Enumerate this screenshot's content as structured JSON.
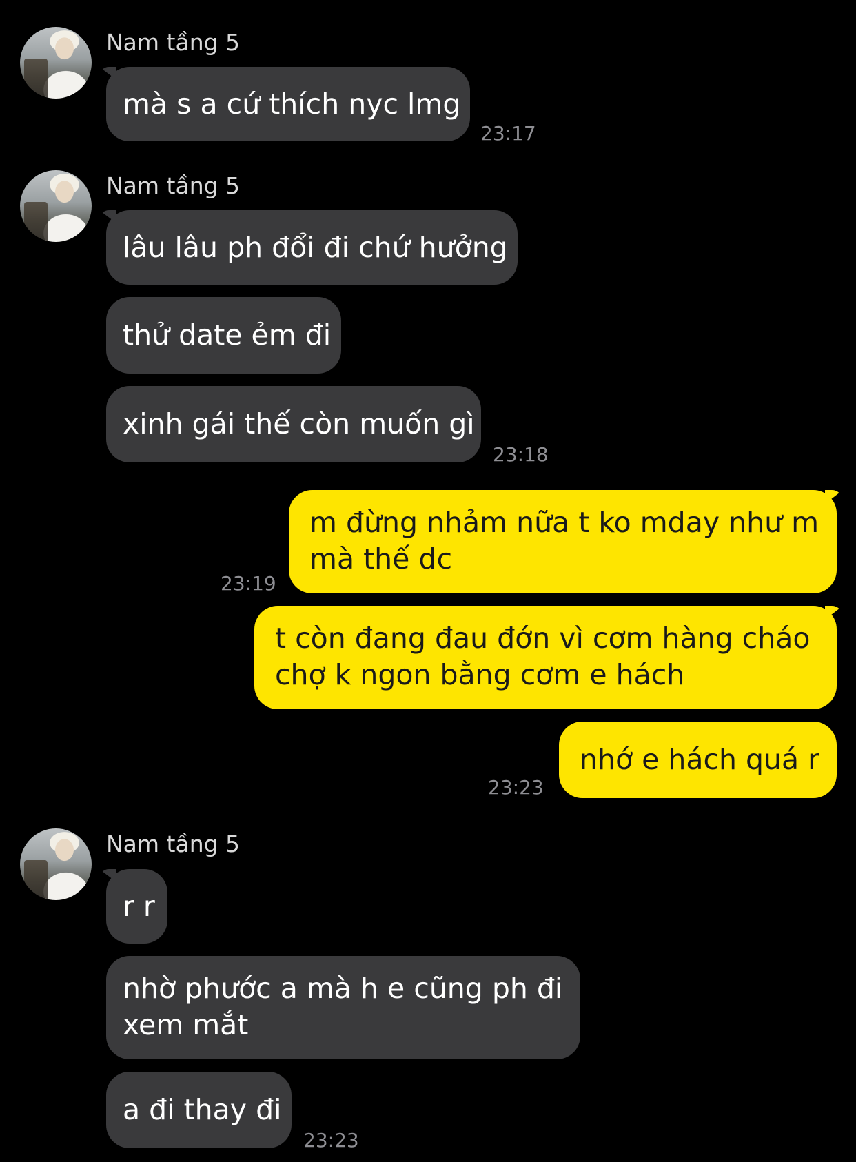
{
  "chat": {
    "groups": [
      {
        "sender": "Nam tầng 5",
        "messages": [
          "mà s a cứ thích nyc lmg"
        ],
        "time": "23:17"
      },
      {
        "sender": "Nam tầng 5",
        "messages": [
          "lâu lâu ph đổi đi chứ hưởng",
          "thử date ẻm đi",
          "xinh gái thế còn muốn gì"
        ],
        "time": "23:18"
      },
      {
        "sender": "me",
        "messages": [
          [
            "m đừng nhảm nữa t ko mday như m",
            "mà thế dc"
          ]
        ],
        "time": "23:19"
      },
      {
        "sender": "me",
        "messages": [
          [
            "t còn đang đau đớn vì cơm hàng cháo",
            "chợ k ngon bằng cơm e hách"
          ],
          "nhớ e hách quá r"
        ],
        "time": "23:23"
      },
      {
        "sender": "Nam tầng 5",
        "messages": [
          "r r",
          [
            "nhờ phước a mà h e cũng ph đi",
            "xem mắt"
          ],
          "a đi thay đi"
        ],
        "time": "23:23"
      }
    ]
  },
  "colors": {
    "background": "#000000",
    "incoming_bubble": "#3a3a3c",
    "outgoing_bubble": "#fee500",
    "timestamp": "#8e8e93"
  },
  "icons": {
    "avatar": "profile-photo-avatar"
  }
}
